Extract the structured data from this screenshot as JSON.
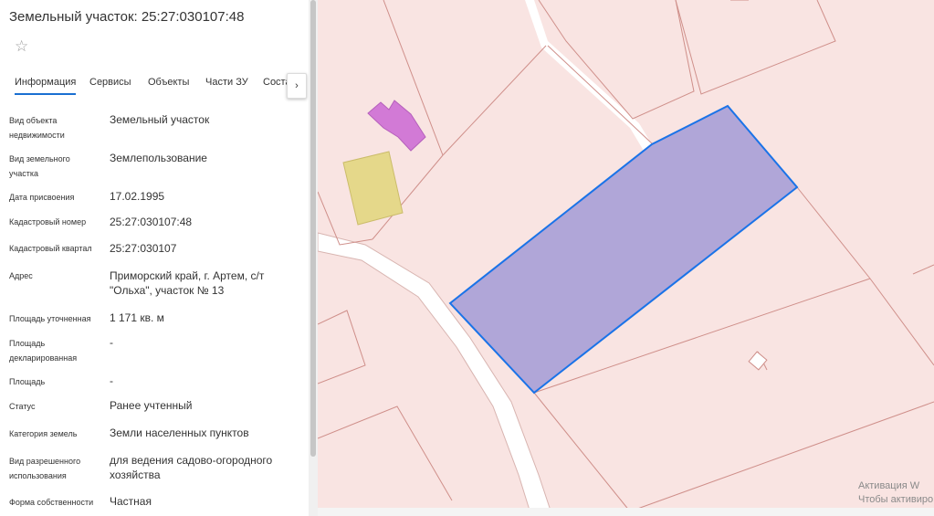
{
  "header": {
    "title": "Земельный участок: 25:27:030107:48",
    "favorite_icon": "star-outline-icon"
  },
  "tabs": [
    {
      "label": "Информация",
      "active": true
    },
    {
      "label": "Сервисы",
      "active": false
    },
    {
      "label": "Объекты",
      "active": false
    },
    {
      "label": "Части ЗУ",
      "active": false
    },
    {
      "label": "Соста",
      "active": false
    }
  ],
  "tabs_scroll_icon": "›",
  "properties": [
    {
      "label": "Вид объекта недвижимости",
      "value": "Земельный участок"
    },
    {
      "label": "Вид земельного участка",
      "value": "Землепользование"
    },
    {
      "label": "Дата присвоения",
      "value": "17.02.1995"
    },
    {
      "label": "Кадастровый номер",
      "value": "25:27:030107:48"
    },
    {
      "label": "Кадастровый квартал",
      "value": "25:27:030107"
    },
    {
      "label": "Адрес",
      "value": "Приморский край, г. Артем, с/т \"Ольха\", участок № 13"
    },
    {
      "label": "Площадь уточненная",
      "value": "1 171 кв. м"
    },
    {
      "label": "Площадь декларированная",
      "value": "-"
    },
    {
      "label": "Площадь",
      "value": "-"
    },
    {
      "label": "Статус",
      "value": "Ранее учтенный"
    },
    {
      "label": "Категория земель",
      "value": "Земли населенных пунктов"
    },
    {
      "label": "Вид разрешенного использования",
      "value": "для ведения садово-огородного хозяйства"
    },
    {
      "label": "Форма собственности",
      "value": "Частная"
    }
  ],
  "map": {
    "watermark_line1": "Активация W",
    "watermark_line2": "Чтобы активиро",
    "colors": {
      "parcel_fill": "#f9e4e2",
      "parcel_border": "#cf8f8a",
      "road": "#ffffff",
      "selected_fill": "#a79fd7",
      "selected_border": "#1a73e8",
      "building_pink": "#d27ad6",
      "building_yellow": "#e5d88a"
    }
  }
}
